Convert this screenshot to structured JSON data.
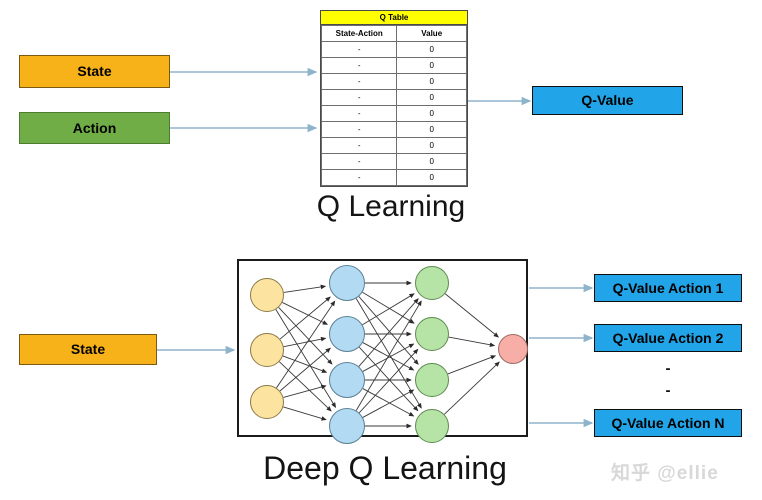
{
  "diagram": {
    "watermark": "知乎 @ellie",
    "colors": {
      "state_fill": "#F8B219",
      "action_fill": "#70AD47",
      "qvalue_fill": "#22A5E8",
      "table_header_fill": "#FFFF00",
      "arrow": "#8EB4CB",
      "node_input": "#FCE3A0",
      "node_hidden1": "#B2DBF3",
      "node_hidden2": "#B6E3A6",
      "node_output": "#F6AEA6"
    }
  },
  "q_learning": {
    "title": "Q Learning",
    "state_label": "State",
    "action_label": "Action",
    "output_label": "Q-Value",
    "table": {
      "title": "Q Table",
      "columns": [
        "State-Action",
        "Value"
      ],
      "rows": [
        [
          "-",
          "0"
        ],
        [
          "-",
          "0"
        ],
        [
          "-",
          "0"
        ],
        [
          "-",
          "0"
        ],
        [
          "-",
          "0"
        ],
        [
          "-",
          "0"
        ],
        [
          "-",
          "0"
        ],
        [
          "-",
          "0"
        ],
        [
          "-",
          "0"
        ]
      ]
    }
  },
  "deep_q_learning": {
    "title": "Deep Q Learning",
    "state_label": "State",
    "outputs": [
      "Q-Value Action 1",
      "Q-Value Action 2",
      "Q-Value Action N"
    ],
    "ellipsis": [
      "-",
      "-"
    ],
    "network": {
      "layers": [
        {
          "name": "input-layer",
          "count": 3
        },
        {
          "name": "hidden-layer-1",
          "count": 4
        },
        {
          "name": "hidden-layer-2",
          "count": 4
        },
        {
          "name": "output-layer",
          "count": 1
        }
      ]
    }
  }
}
